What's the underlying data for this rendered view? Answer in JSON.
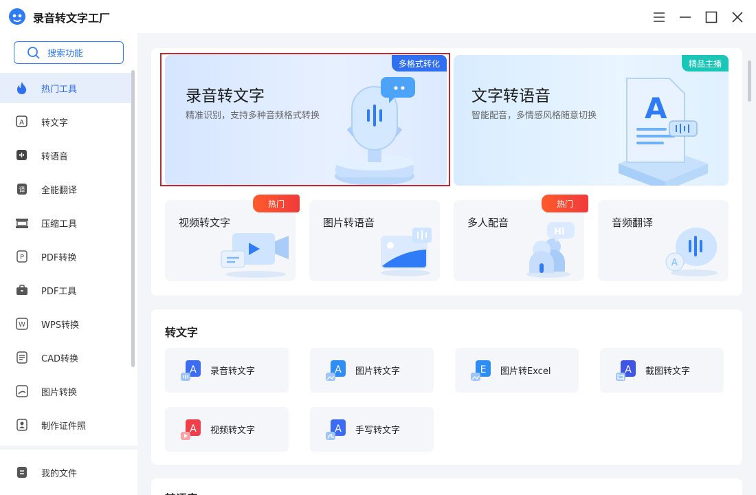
{
  "window": {
    "title": "录音转文字工厂",
    "controls": [
      "menu",
      "minimize",
      "maximize",
      "close"
    ]
  },
  "sidebar": {
    "search_label": "搜索功能",
    "items": [
      {
        "label": "热门工具",
        "icon": "flame-icon",
        "active": true
      },
      {
        "label": "转文字",
        "icon": "text-a-icon"
      },
      {
        "label": "转语音",
        "icon": "voice-icon"
      },
      {
        "label": "全能翻译",
        "icon": "translate-icon"
      },
      {
        "label": "压缩工具",
        "icon": "compress-icon"
      },
      {
        "label": "PDF转换",
        "icon": "pdf-convert-icon"
      },
      {
        "label": "PDF工具",
        "icon": "toolbox-icon"
      },
      {
        "label": "WPS转换",
        "icon": "wps-icon"
      },
      {
        "label": "CAD转换",
        "icon": "cad-icon"
      },
      {
        "label": "图片转换",
        "icon": "image-icon"
      },
      {
        "label": "制作证件照",
        "icon": "id-photo-icon"
      }
    ],
    "bottom_item": {
      "label": "我的文件",
      "icon": "file-icon"
    }
  },
  "hot": {
    "banners": [
      {
        "title": "录音转文字",
        "subtitle": "精准识别，支持多种音频格式转换",
        "ribbon": "多格式转化",
        "ribbon_color": "#2f6ff0",
        "icon": "microphone-illustration"
      },
      {
        "title": "文字转语音",
        "subtitle": "智能配音，多情感风格随意切换",
        "ribbon": "精品主播",
        "ribbon_color": "#19c6b8",
        "icon": "document-a-illustration"
      }
    ],
    "tools": [
      {
        "label": "视频转文字",
        "badge": "热门",
        "icon": "video-camera-icon"
      },
      {
        "label": "图片转语音",
        "badge": "",
        "icon": "picture-icon"
      },
      {
        "label": "多人配音",
        "badge": "热门",
        "icon": "people-icon"
      },
      {
        "label": "音频翻译",
        "badge": "",
        "icon": "speech-bubble-icon"
      }
    ]
  },
  "to_text": {
    "title": "转文字",
    "items": [
      {
        "label": "录音转文字",
        "letter": "A",
        "color": "#3b6cf2"
      },
      {
        "label": "图片转文字",
        "letter": "A",
        "color": "#2f8ef5"
      },
      {
        "label": "图片转Excel",
        "letter": "E",
        "color": "#2f8ef5"
      },
      {
        "label": "截图转文字",
        "letter": "A",
        "color": "#3f55e6"
      },
      {
        "label": "视频转文字",
        "letter": "A",
        "color": "#ef3f4a"
      },
      {
        "label": "手写转文字",
        "letter": "A",
        "color": "#3b6cf2"
      }
    ]
  },
  "next_section": {
    "title": "转语音"
  }
}
